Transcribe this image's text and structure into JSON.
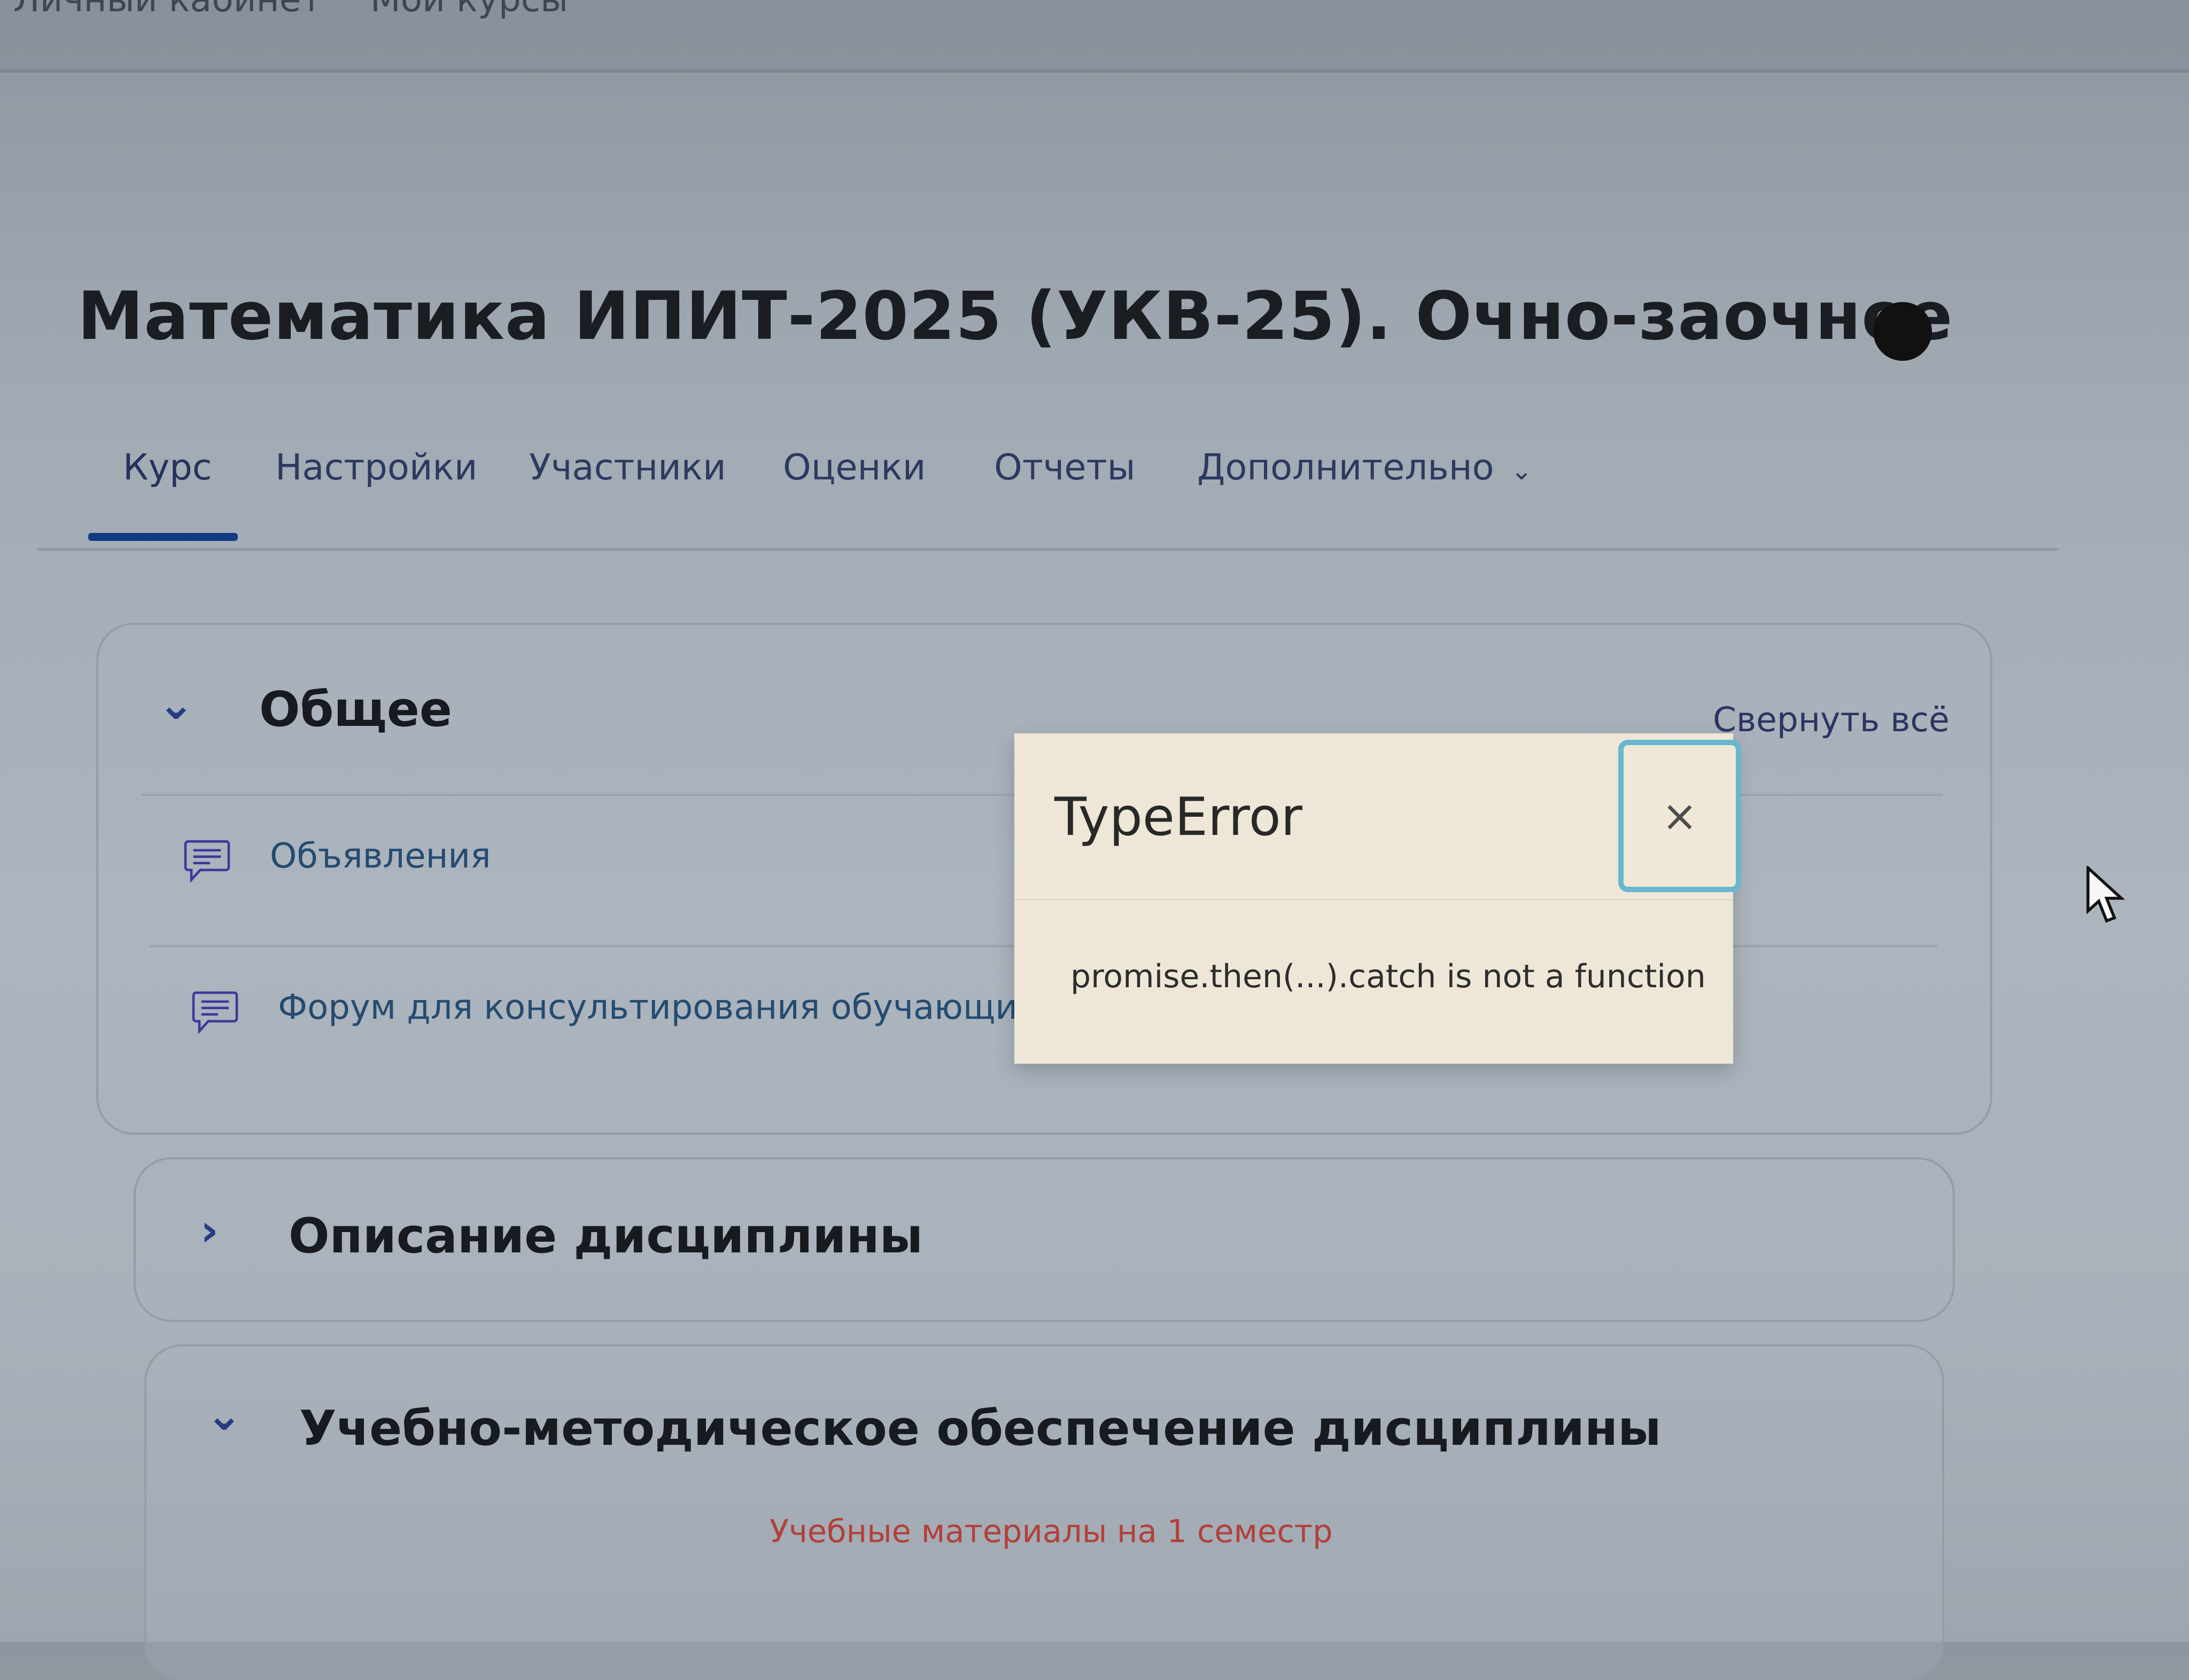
{
  "topnav": {
    "item_a": "Личный кабинет",
    "item_b": "Мои курсы"
  },
  "course": {
    "title": "Математика ИПИТ-2025 (УКВ-25). Очно-заочное"
  },
  "tabs": [
    {
      "label": "Курс"
    },
    {
      "label": "Настройки"
    },
    {
      "label": "Участники"
    },
    {
      "label": "Оценки"
    },
    {
      "label": "Отчеты"
    },
    {
      "label": "Дополнительно"
    }
  ],
  "sections": {
    "general": {
      "title": "Общее",
      "collapse_all": "Свернуть всё",
      "items": [
        {
          "label": "Объявления"
        },
        {
          "label": "Форум для консультирования обучающихся"
        }
      ]
    },
    "description": {
      "title": "Описание дисциплины"
    },
    "support": {
      "title": "Учебно-методическое обеспечение дисциплины",
      "materials": "Учебные материалы на 1 семестр"
    }
  },
  "dialog": {
    "title": "TypeError",
    "close": "×",
    "message": "promise.then(...).catch is not a function"
  },
  "icons": {
    "info": "info-icon",
    "forum": "forum-icon",
    "chevron_down": "chevron-down-icon",
    "chevron_right": "chevron-right-icon",
    "close": "close-icon",
    "cursor": "mouse-pointer-icon"
  },
  "colors": {
    "accent": "#123a83",
    "link": "#244b70",
    "materials": "#b24039",
    "dialog_bg": "#eee7d7",
    "focus_ring": "#67b7ce"
  }
}
